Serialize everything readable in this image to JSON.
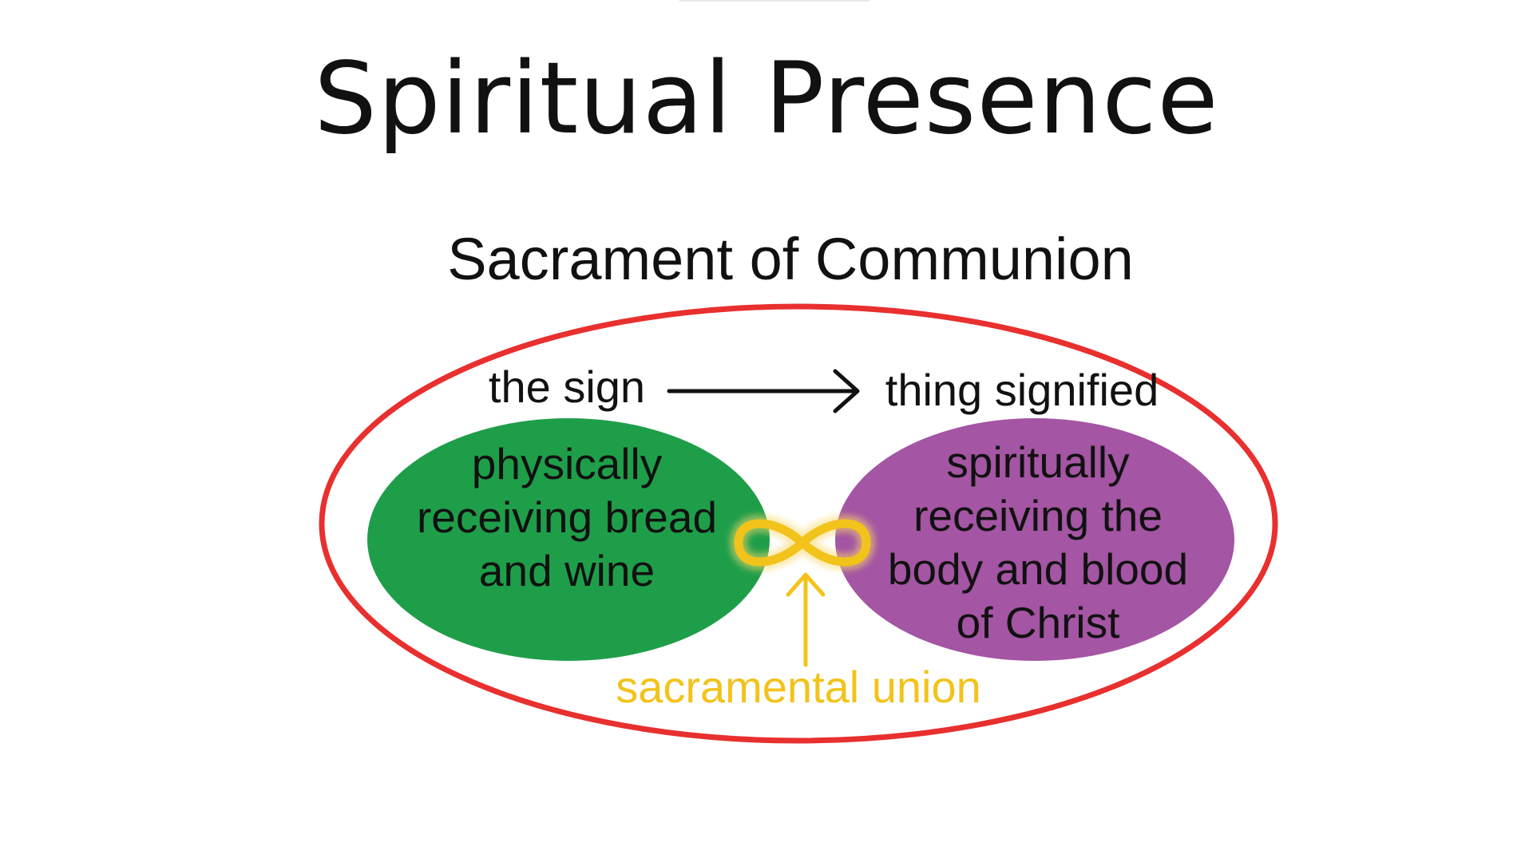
{
  "slide": {
    "title": "Spiritual Presence",
    "subtitle": "Sacrament of Communion"
  },
  "diagram": {
    "sign_label": "the sign",
    "signified_label": "thing signified",
    "physical_text": "physically\nreceiving bread\nand wine",
    "spiritual_text": "spiritually\nreceiving the\nbody and blood\nof Christ",
    "union_label": "sacramental union",
    "icons": [
      "arrow-right-icon",
      "infinity-icon",
      "arrow-up-icon"
    ]
  },
  "colors": {
    "outer_ring": "#e8302f",
    "physical_fill": "#1f9e4a",
    "spiritual_fill": "#a455a3",
    "union": "#f2c31b",
    "text": "#111111"
  }
}
